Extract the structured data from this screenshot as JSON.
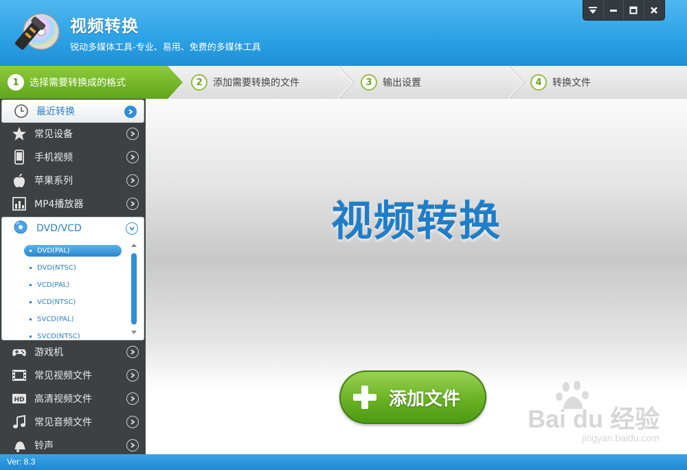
{
  "app": {
    "title": "视频转换",
    "subtitle": "锐动多媒体工具-专业、易用、免费的多媒体工具"
  },
  "window_controls": [
    "menu-down",
    "minimize",
    "maximize",
    "close"
  ],
  "steps": [
    {
      "num": "1",
      "label": "选择需要转换成的格式",
      "active": true
    },
    {
      "num": "2",
      "label": "添加需要转换的文件",
      "active": false
    },
    {
      "num": "3",
      "label": "输出设置",
      "active": false
    },
    {
      "num": "4",
      "label": "转换文件",
      "active": false
    }
  ],
  "sidebar": {
    "items": [
      {
        "label": "最近转换",
        "icon": "clock-icon"
      },
      {
        "label": "常见设备",
        "icon": "star-icon"
      },
      {
        "label": "手机视频",
        "icon": "phone-icon"
      },
      {
        "label": "苹果系列",
        "icon": "apple-icon"
      },
      {
        "label": "MP4播放器",
        "icon": "mp4-player-icon"
      },
      {
        "label": "DVD/VCD",
        "icon": "disc-icon"
      },
      {
        "label": "游戏机",
        "icon": "gamepad-icon"
      },
      {
        "label": "常见视频文件",
        "icon": "film-icon"
      },
      {
        "label": "高清视频文件",
        "icon": "hd-icon"
      },
      {
        "label": "常见音频文件",
        "icon": "music-icon"
      },
      {
        "label": "铃声",
        "icon": "bell-icon"
      }
    ],
    "sub_items": [
      "DVD(PAL)",
      "DVD(NTSC)",
      "VCD(PAL)",
      "VCD(NTSC)",
      "SVCD(PAL)",
      "SVCD(NTSC)"
    ],
    "selected_sub": "DVD(PAL)"
  },
  "main": {
    "hero_title": "视频转换",
    "add_button": "添加文件"
  },
  "watermark": {
    "main": "Bai du 经验",
    "sub": "jingyan.baidu.com"
  },
  "status": {
    "version": "Ver: 8.3"
  },
  "colors": {
    "header_blue": "#2ea3e6",
    "active_step_green": "#6db426",
    "sidebar_dark": "#3d4144",
    "accent_blue": "#2a7fc4"
  }
}
